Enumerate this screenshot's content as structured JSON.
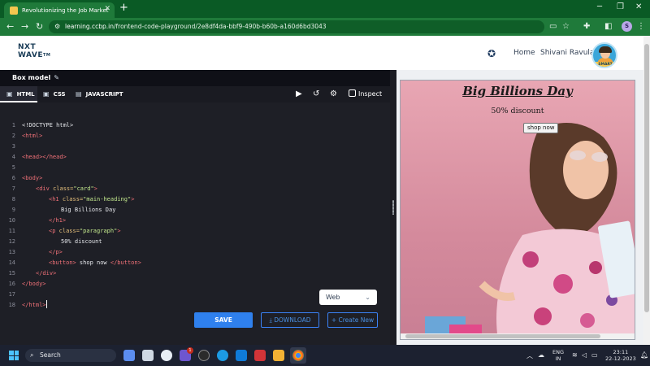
{
  "browser": {
    "tab_title": "Revolutionizing the Job Market",
    "url_host": "learning.ccbp.in",
    "url_path": "/frontend-code-playground/2e8df4da-bbf9-490b-b60b-a160d6bd3043",
    "profile_initial": "S"
  },
  "app_header": {
    "logo_line1": "NXT",
    "logo_line2": "WAVE",
    "logo_tm": "TM",
    "home_label": "Home",
    "user_name": "Shivani Ravula",
    "avatar_badge": "SMART"
  },
  "editor": {
    "title": "Box model",
    "tabs": [
      {
        "label": "HTML",
        "active": true
      },
      {
        "label": "CSS",
        "active": false
      },
      {
        "label": "JAVASCRIPT",
        "active": false
      }
    ],
    "inspect_label": "Inspect",
    "line_numbers": [
      "1",
      "2",
      "3",
      "4",
      "5",
      "6",
      "7",
      "8",
      "9",
      "10",
      "11",
      "12",
      "13",
      "14",
      "15",
      "16",
      "17",
      "18"
    ],
    "code": {
      "l1": "<!DOCTYPE html>",
      "l2_tag": "<html>",
      "l4_tag": "<head></head>",
      "l6_tag": "<body>",
      "l7_open": "<div",
      "l7_attr": "class=",
      "l7_val": "\"card\"",
      "l7_close": ">",
      "l8_open": "<h1",
      "l8_attr": "class=",
      "l8_val": "\"main-heading\"",
      "l8_close": ">",
      "l9_text": "Big Billions Day",
      "l10_tag": "</h1>",
      "l11_open": "<p",
      "l11_attr": "class=",
      "l11_val": "\"paragraph\"",
      "l11_close": ">",
      "l12_text": "50% discount",
      "l13_tag": "</p>",
      "l14_open": "<button>",
      "l14_text": " shop now ",
      "l14_close": "</button>",
      "l15_tag": "</div>",
      "l16_tag": "</body>",
      "l18_tag": "</html>"
    },
    "view_select": "Web",
    "save_label": "SAVE",
    "download_label": "DOWNLOAD",
    "create_new_label": "Create New"
  },
  "preview": {
    "heading": "Big Billions Day",
    "paragraph": "50% discount",
    "button": "shop now"
  },
  "taskbar": {
    "search_label": "Search",
    "lang_line1": "ENG",
    "lang_line2": "IN",
    "time": "23:11",
    "date": "22-12-2023",
    "notif_badge": "1"
  },
  "colors": {
    "chrome_green": "#1f7a3a",
    "editor_bg": "#1e1f26",
    "save_blue": "#2f80ed",
    "preview_pink": "#e8a6b3"
  }
}
